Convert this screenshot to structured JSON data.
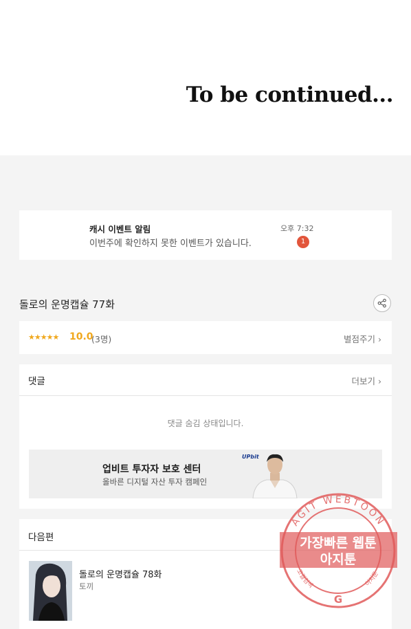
{
  "end_banner": {
    "text": "To be continued..."
  },
  "notification": {
    "title": "캐시 이벤트 알림",
    "message": "이번주에 확인하지 못한 이벤트가 있습니다.",
    "time": "오후 7:32",
    "badge_count": "1"
  },
  "episode": {
    "title": "돌로의 운명캡슐 77화",
    "stars": "★★★★★",
    "score": "10.0",
    "rating_count": "(3명)",
    "rate_link": "별점주기 ›"
  },
  "comments": {
    "header": "댓글",
    "more_link": "더보기 ›",
    "hidden_message": "댓글 숨김 상태입니다."
  },
  "ad": {
    "title": "업비트 투자자 보호 센터",
    "subtitle": "올바른 디지털 자산 투자 캠페인",
    "logo": "UPbit"
  },
  "next_episode": {
    "header": "다음편",
    "title": "돌로의 운명캡슐 78화",
    "author": "토끼"
  },
  "watermark": {
    "ring_text": "AGIT WEBTOON",
    "line1": "가장빠른 웹툰",
    "line2": "아지툰",
    "bottom_left": "고퀄검색",
    "bottom_right": "아지툰",
    "logo_letter": "G"
  },
  "colors": {
    "accent_star": "#f0a81e",
    "badge": "#e2553b",
    "stamp": "#e05a5a"
  }
}
